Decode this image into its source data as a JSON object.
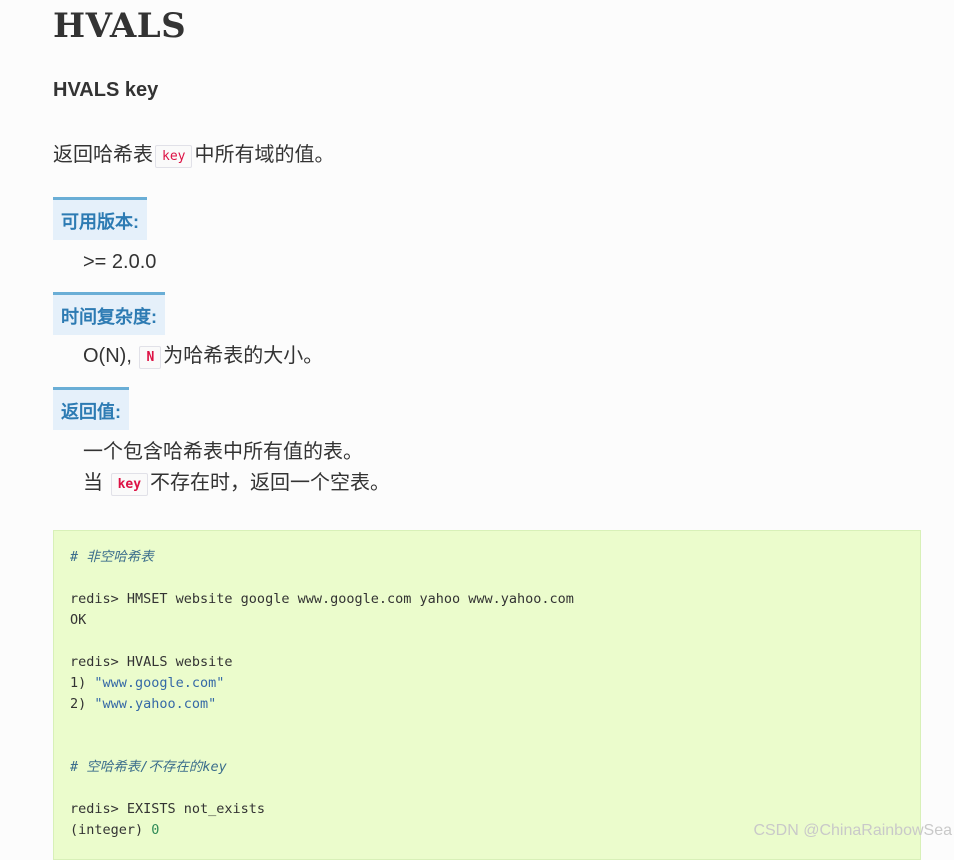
{
  "title": "HVALS",
  "signature": "HVALS key",
  "description": {
    "before": "返回哈希表",
    "code": "key",
    "after": "中所有域的值。"
  },
  "sections": {
    "version": {
      "heading": "可用版本:",
      "text": ">= 2.0.0"
    },
    "complexity": {
      "heading": "时间复杂度:",
      "before": "O(N),",
      "code": "N",
      "after": "为哈希表的大小。"
    },
    "returns": {
      "heading": "返回值:",
      "line1": "一个包含哈希表中所有值的表。",
      "line2_before": "当",
      "line2_code": "key",
      "line2_after": "不存在时，返回一个空表。"
    }
  },
  "code": {
    "comment1": "# 非空哈希表",
    "cmd1": "redis> HMSET website google www.google.com yahoo www.yahoo.com",
    "out1": "OK",
    "cmd2": "redis> HVALS website",
    "out2_prefix": "1) ",
    "out2_value": "\"www.google.com\"",
    "out3_prefix": "2) ",
    "out3_value": "\"www.yahoo.com\"",
    "comment2": "# 空哈希表/不存在的key",
    "cmd3": "redis> EXISTS not_exists",
    "out4_prefix": "(integer) ",
    "out4_value": "0"
  },
  "watermark": "CSDN @ChinaRainbowSea"
}
